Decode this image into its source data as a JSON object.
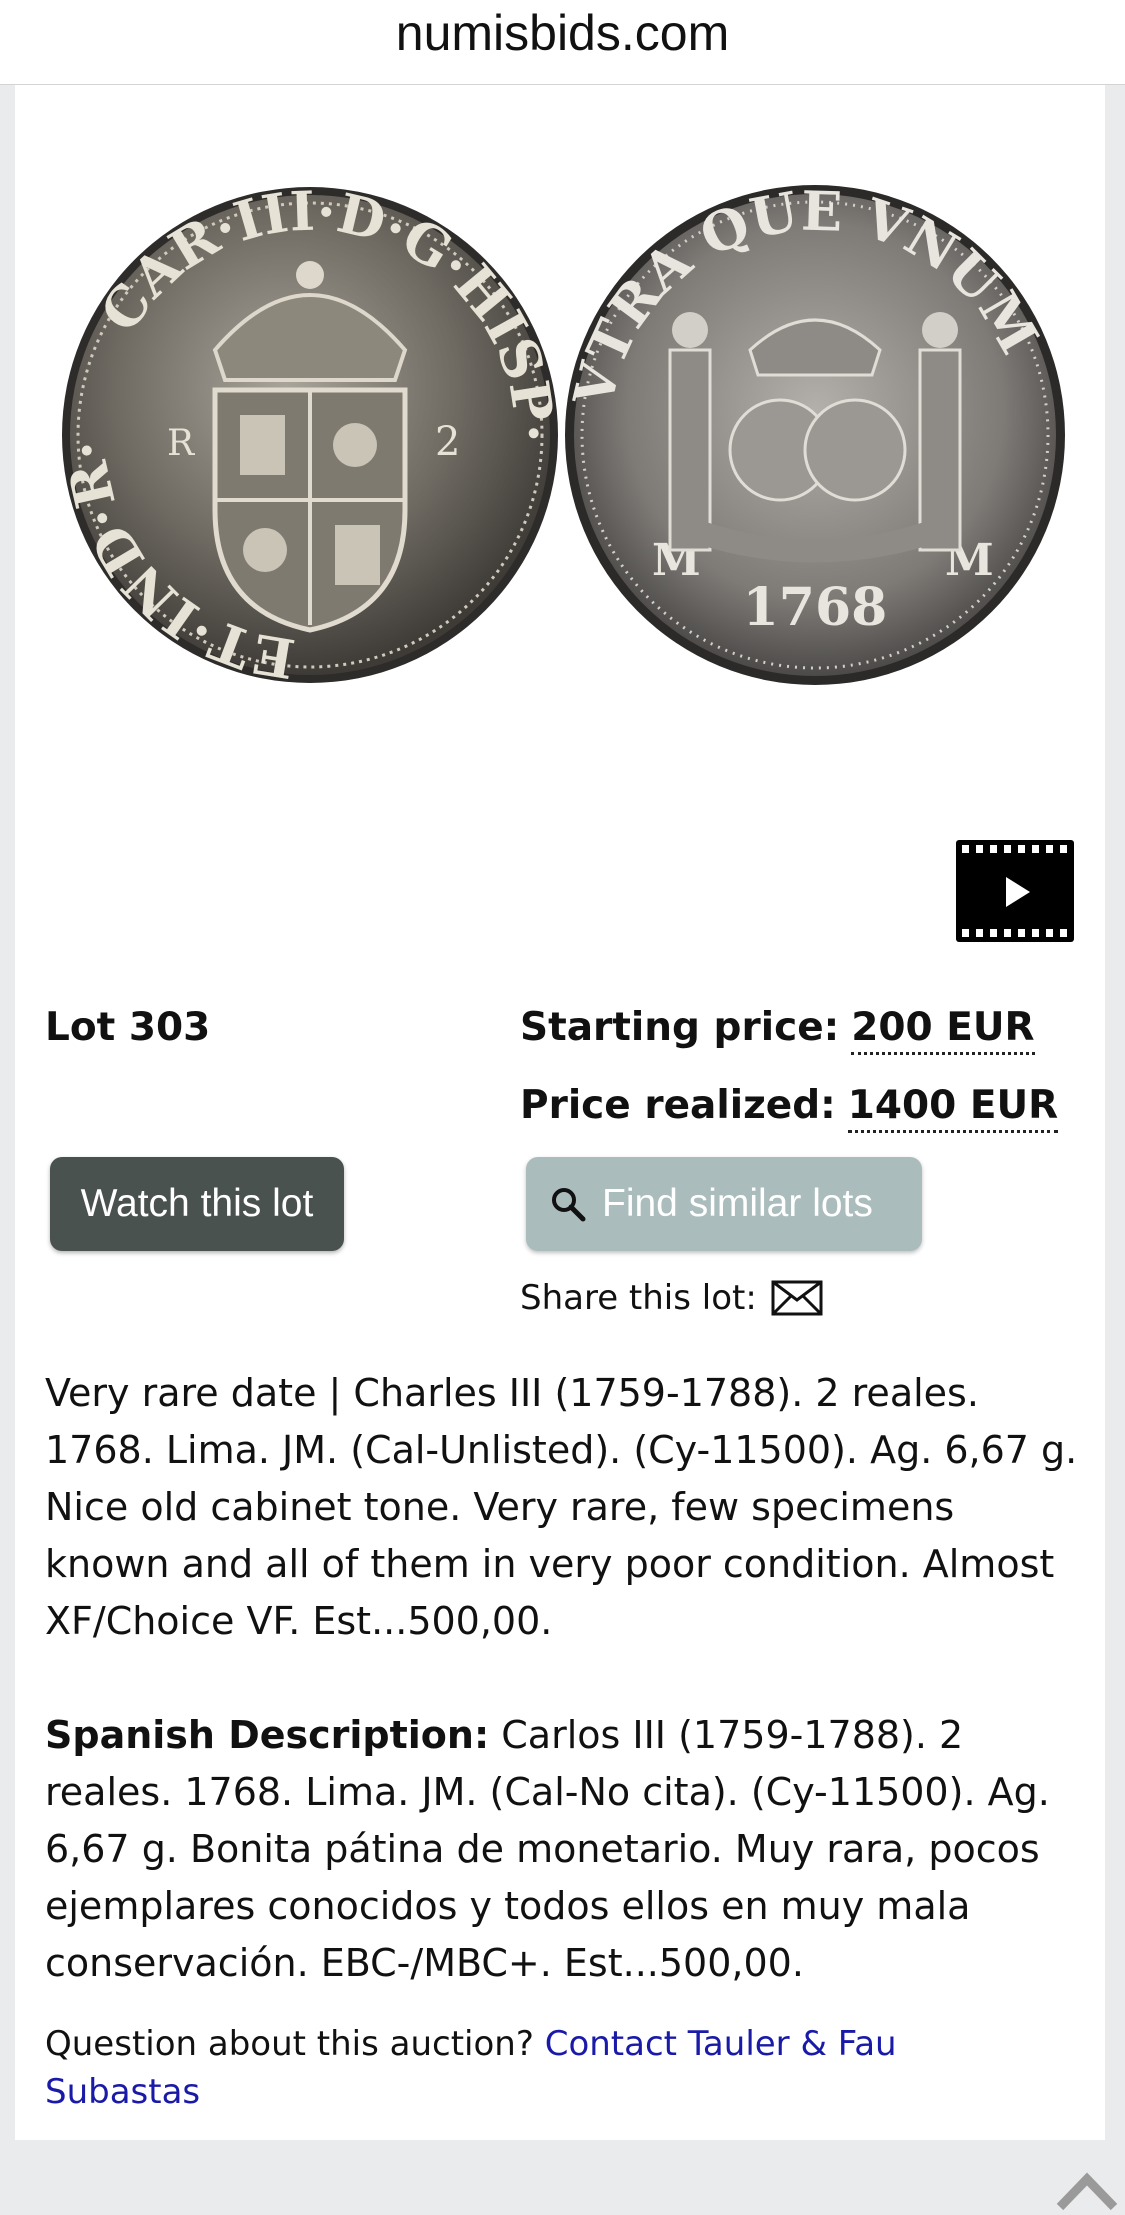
{
  "browser": {
    "domain": "numisbids.com"
  },
  "lot": {
    "label": "Lot 303",
    "starting_price_label": "Starting price:",
    "starting_price_value": "200 EUR",
    "price_realized_label": "Price realized:",
    "price_realized_value": "1400 EUR"
  },
  "coin_images": {
    "obverse": {
      "legend_left": "ET·IND·R·",
      "legend_right": "CAR·III·D·G·HISP·",
      "mintmark": "R",
      "denomination": "2"
    },
    "reverse": {
      "legend": "VTRA QUE VNUM",
      "date": "1768",
      "mint_left": "M",
      "mint_right": "M"
    }
  },
  "video": {
    "icon": "video-play-icon"
  },
  "actions": {
    "watch_label": "Watch this lot",
    "find_similar_label": "Find similar lots",
    "share_label": "Share this lot:"
  },
  "description": {
    "english": "Very rare date | Charles III (1759-1788). 2 reales. 1768. Lima. JM. (Cal-Unlisted). (Cy-11500). Ag. 6,67 g. Nice old cabinet tone. Very rare, few specimens known and all of them in very poor condition. Almost XF/Choice VF. Est...500,00.",
    "spanish_label": "Spanish Description:",
    "spanish": "Carlos III (1759-1788). 2 reales. 1768. Lima. JM. (Cal-No cita). (Cy-11500). Ag. 6,67 g. Bonita pátina de monetario. Muy rara, pocos ejemplares conocidos y todos ellos en muy mala conservación. EBC-/MBC+. Est...500,00."
  },
  "footer": {
    "question_text": "Question about this auction?",
    "contact_link": "Contact Tauler & Fau Subastas"
  },
  "colors": {
    "watch_bg": "#4a524f",
    "find_bg": "#aabcbc",
    "link": "#1a1aa8"
  }
}
